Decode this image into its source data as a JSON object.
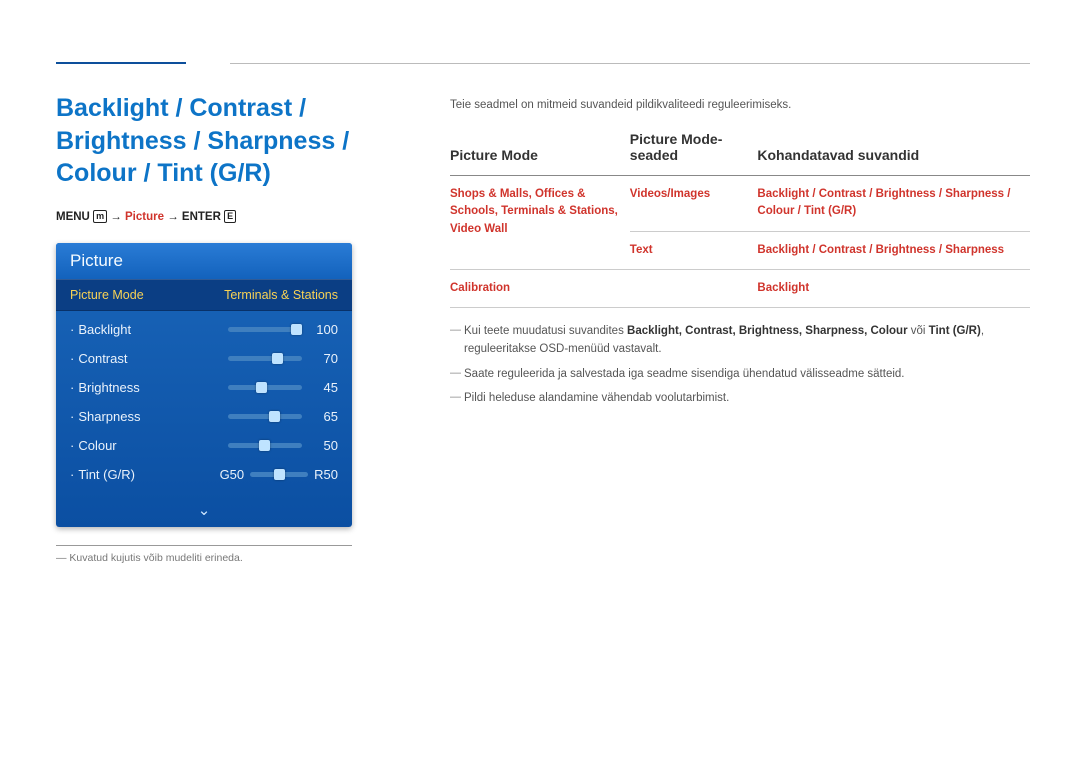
{
  "heading": "Backlight / Contrast / Brightness / Sharpness / Colour / Tint (G/R)",
  "menupath": {
    "menu": "MENU",
    "picture": "Picture",
    "enter": "ENTER",
    "arrow": "→"
  },
  "osd": {
    "title": "Picture",
    "modeLabel": "Picture Mode",
    "modeValue": "Terminals & Stations",
    "items": [
      {
        "label": "Backlight",
        "value": "100",
        "pos": 100
      },
      {
        "label": "Contrast",
        "value": "70",
        "pos": 70
      },
      {
        "label": "Brightness",
        "value": "45",
        "pos": 45
      },
      {
        "label": "Sharpness",
        "value": "65",
        "pos": 65
      },
      {
        "label": "Colour",
        "value": "50",
        "pos": 50
      }
    ],
    "tint": {
      "label": "Tint (G/R)",
      "left": "G50",
      "right": "R50",
      "pos": 50
    },
    "chevron": "⌄"
  },
  "disclaimer": "― Kuvatud kujutis võib mudeliti erineda.",
  "intro": "Teie seadmel on mitmeid suvandeid pildikvaliteedi reguleerimiseks.",
  "table": {
    "headers": {
      "col1": "Picture Mode",
      "col2": "Picture Mode-seaded",
      "col3": "Kohandatavad suvandid"
    },
    "rows": [
      {
        "col1": "Shops & Malls, Offices & Schools, Terminals & Stations, Video Wall",
        "col2": "Videos/Images",
        "col3": "Backlight / Contrast / Brightness / Sharpness / Colour / Tint (G/R)",
        "rowspan1": 2
      },
      {
        "col2": "Text",
        "col3": "Backlight / Contrast / Brightness / Sharpness"
      },
      {
        "col1": "Calibration",
        "col2": "",
        "col3": "Backlight"
      }
    ]
  },
  "notes": [
    {
      "pre": "Kui teete muudatusi suvandites ",
      "bold": "Backlight, Contrast, Brightness, Sharpness, Colour",
      "mid": " või ",
      "bold2": "Tint (G/R)",
      "post": ", reguleeritakse OSD-menüüd vastavalt."
    },
    {
      "text": "Saate reguleerida ja salvestada iga seadme sisendiga ühendatud välisseadme sätteid."
    },
    {
      "text": "Pildi heleduse alandamine vähendab voolutarbimist."
    }
  ]
}
